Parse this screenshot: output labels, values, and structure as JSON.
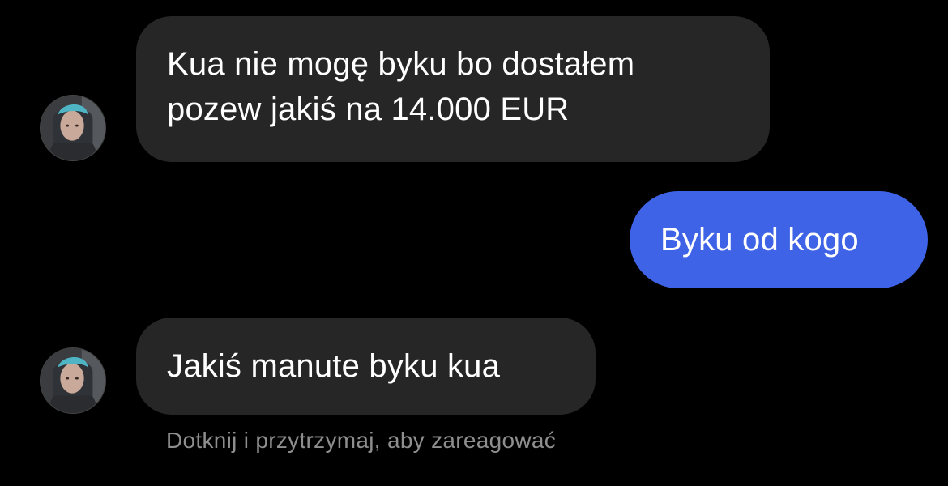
{
  "colors": {
    "background": "#000000",
    "incoming_bubble": "#262626",
    "outgoing_bubble": "#3f63e6",
    "hint_text": "#8e8e8e"
  },
  "messages": [
    {
      "direction": "incoming",
      "text": "Kua nie mogę byku bo dostałem\npozew jakiś na 14.000 EUR",
      "avatar_icon": "contact-avatar-icon"
    },
    {
      "direction": "outgoing",
      "text": "Byku od kogo"
    },
    {
      "direction": "incoming",
      "text": "Jakiś manute byku kua",
      "avatar_icon": "contact-avatar-icon"
    }
  ],
  "reaction_hint": "Dotknij i przytrzymaj, aby zareagować"
}
